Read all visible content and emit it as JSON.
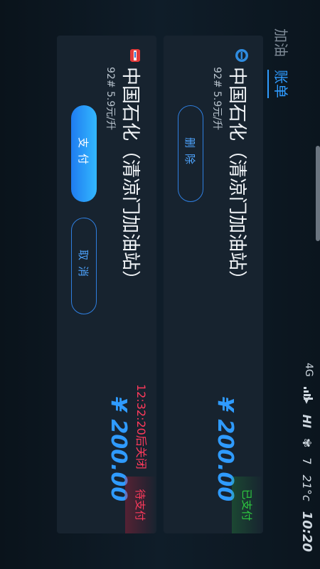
{
  "status_bar": {
    "time": "10:20",
    "temperature": "21°c",
    "fan_level": "7",
    "hi": "HI",
    "network": "4G"
  },
  "nav": {
    "tabs": [
      {
        "label": "加油",
        "active": false
      },
      {
        "label": "账单",
        "active": true
      }
    ]
  },
  "bills": [
    {
      "station": "中国石化（清凉门加油站）",
      "fuel_info": "92#  5.9元/升",
      "amount": "¥ 200.00",
      "status": "已支付",
      "actions": {
        "delete": "删除"
      }
    },
    {
      "station": "中国石化（清凉门加油站）",
      "fuel_info": "92#  5.9元/升",
      "amount": "¥ 200.00",
      "status": "待支付",
      "countdown": "12:32:20后关闭",
      "actions": {
        "pay": "支付",
        "cancel": "取消"
      }
    }
  ],
  "colors": {
    "accent": "#2f9bff",
    "paid": "#2ecc40",
    "pending": "#ff3a5c",
    "card_bg": "#17232f"
  }
}
